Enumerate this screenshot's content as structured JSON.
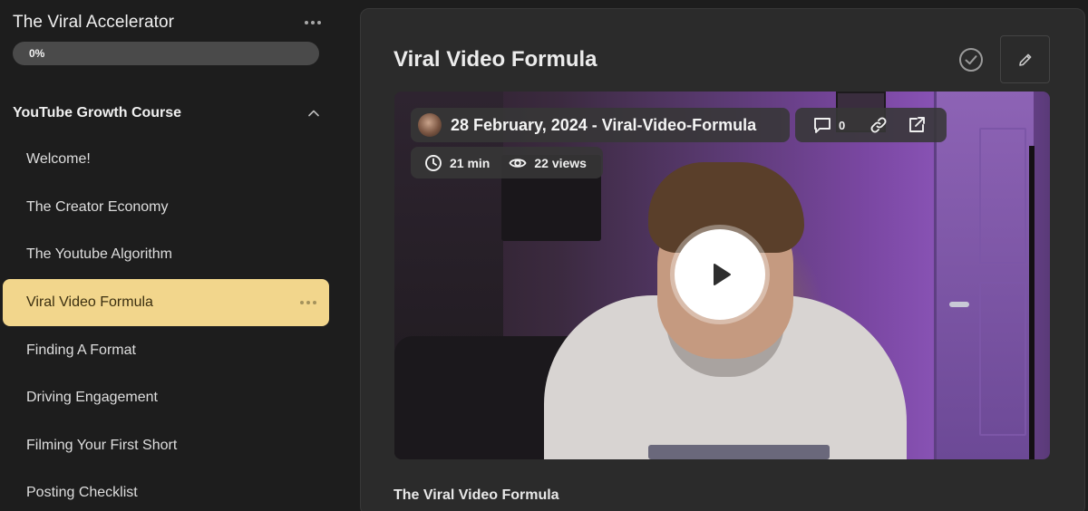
{
  "sidebar": {
    "course_title": "The Viral Accelerator",
    "progress": {
      "percent": 0,
      "label": "0%"
    },
    "section": {
      "title": "YouTube Growth Course",
      "expanded": true,
      "lessons": [
        {
          "label": "Welcome!",
          "active": false
        },
        {
          "label": "The Creator Economy",
          "active": false
        },
        {
          "label": "The Youtube Algorithm",
          "active": false
        },
        {
          "label": "Viral Video Formula",
          "active": true
        },
        {
          "label": "Finding A Format",
          "active": false
        },
        {
          "label": "Driving Engagement",
          "active": false
        },
        {
          "label": "Filming Your First Short",
          "active": false
        },
        {
          "label": "Posting Checklist",
          "active": false
        }
      ]
    }
  },
  "main": {
    "title": "Viral Video Formula",
    "video": {
      "title": "28 February, 2024 - Viral-Video-Formula",
      "comment_count": "0",
      "duration": "21 min",
      "views": "22 views"
    },
    "description_title": "The Viral Video Formula"
  },
  "colors": {
    "active_lesson_bg": "#f2d68c",
    "panel_bg": "#2b2b2b",
    "page_bg": "#1d1d1d"
  },
  "icons": {
    "menu": "more-horizontal-icon",
    "collapse": "chevron-up-icon",
    "complete": "check-circle-icon",
    "edit": "pencil-icon",
    "comment": "message-square-icon",
    "link": "link-icon",
    "open": "external-link-icon",
    "duration": "clock-icon",
    "views": "eye-icon",
    "play": "play-icon"
  }
}
